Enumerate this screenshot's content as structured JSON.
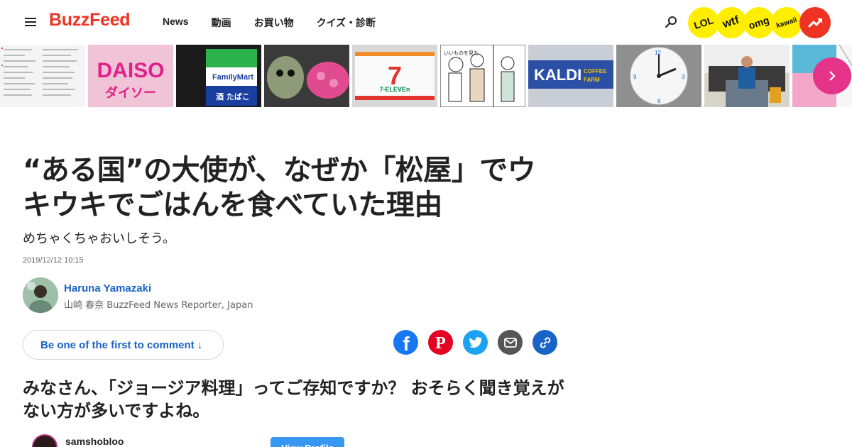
{
  "header": {
    "logo": "BuzzFeed",
    "nav": [
      "News",
      "動画",
      "お買い物",
      "クイズ・診断"
    ],
    "badges": [
      "LOL",
      "wtf",
      "omg",
      "kawaii"
    ],
    "colors": {
      "brand": "#ee3322",
      "badge_yellow": "#ffee00",
      "link_blue": "#1a63c6",
      "next_pink": "#e6338a"
    }
  },
  "strip": {
    "thumbs": [
      {
        "label": ""
      },
      {
        "label": "DAISO"
      },
      {
        "label": "FamilyMart"
      },
      {
        "label": ""
      },
      {
        "label": ""
      },
      {
        "label": "7-ELEVEn"
      },
      {
        "label": "いいものを見た"
      },
      {
        "label": "KALDI"
      },
      {
        "label": ""
      },
      {
        "label": ""
      },
      {
        "label": ""
      }
    ]
  },
  "article": {
    "headline": "“ある国”の大使が、なぜか「松屋」でウキウキでごはんを食べていた理由",
    "dek": "めちゃくちゃおいしそう。",
    "timestamp": "2019/12/12 10:15",
    "author_name": "Haruna Yamazaki",
    "author_role": "山崎 春奈 BuzzFeed News Reporter, Japan",
    "comment_cta": "Be one of the first to comment ↓",
    "subhead": "みなさん、「ジョージア料理」ってご存知ですか？ おそらく聞き覚えがない方が多いですよね。",
    "embed_user": "samshobloo",
    "embed_button": "View Profile"
  }
}
